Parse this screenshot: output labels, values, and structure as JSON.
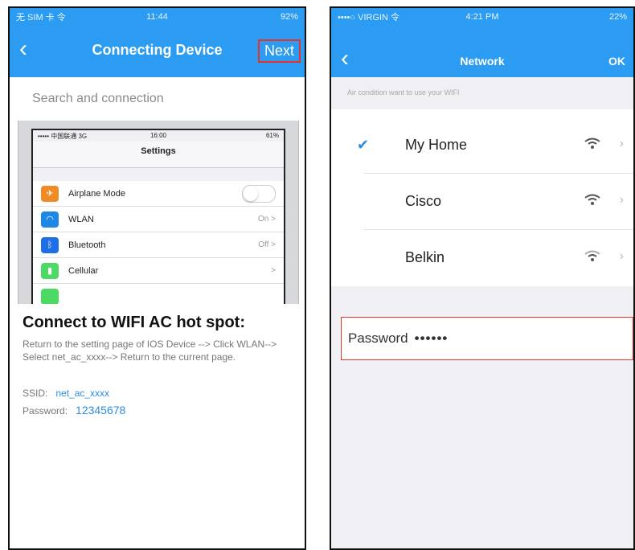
{
  "left": {
    "status": {
      "carrier": "无 SIM 卡 令",
      "time": "11:44",
      "battery": "92%"
    },
    "nav": {
      "back": "‹",
      "title": "Connecting Device",
      "next": "Next"
    },
    "search_label": "Search and connection",
    "settings_screenshot": {
      "status": {
        "carrier": "••••• 中国联通 3G",
        "time": "16:00",
        "battery": "61%"
      },
      "title": "Settings",
      "rows": [
        {
          "icon": "airplane-icon",
          "label": "Airplane Mode",
          "value": "",
          "color": "#f08a24"
        },
        {
          "icon": "wlan-icon",
          "label": "WLAN",
          "value": "On >",
          "color": "#1e88e5"
        },
        {
          "icon": "bluetooth-icon",
          "label": "Bluetooth",
          "value": "Off >",
          "color": "#1e6fe5"
        },
        {
          "icon": "cellular-icon",
          "label": "Cellular",
          "value": ">",
          "color": "#4cd964"
        }
      ]
    },
    "hotspot": {
      "title": "Connect to WIFI AC hot spot:",
      "description": "Return to the setting page of IOS Device --> Click WLAN--> Select net_ac_xxxx--> Return to the current page.",
      "ssid_label": "SSID:",
      "ssid_value": "net_ac_xxxx",
      "password_label": "Password:",
      "password_value": "12345678"
    }
  },
  "right": {
    "status": {
      "carrier": "••••○ VIRGIN 令",
      "time": "4:21 PM",
      "battery": "22%"
    },
    "nav": {
      "back": "‹",
      "title": "Network",
      "ok": "OK"
    },
    "hint": "Air condition want to use your WIFI",
    "networks": [
      {
        "name": "My Home",
        "selected": true
      },
      {
        "name": "Cisco",
        "selected": false
      },
      {
        "name": "Belkin",
        "selected": false
      }
    ],
    "password": {
      "label": "Password",
      "value": "••••••"
    },
    "colors": {
      "accent": "#2b9cf2",
      "highlight": "#e5322d"
    }
  }
}
